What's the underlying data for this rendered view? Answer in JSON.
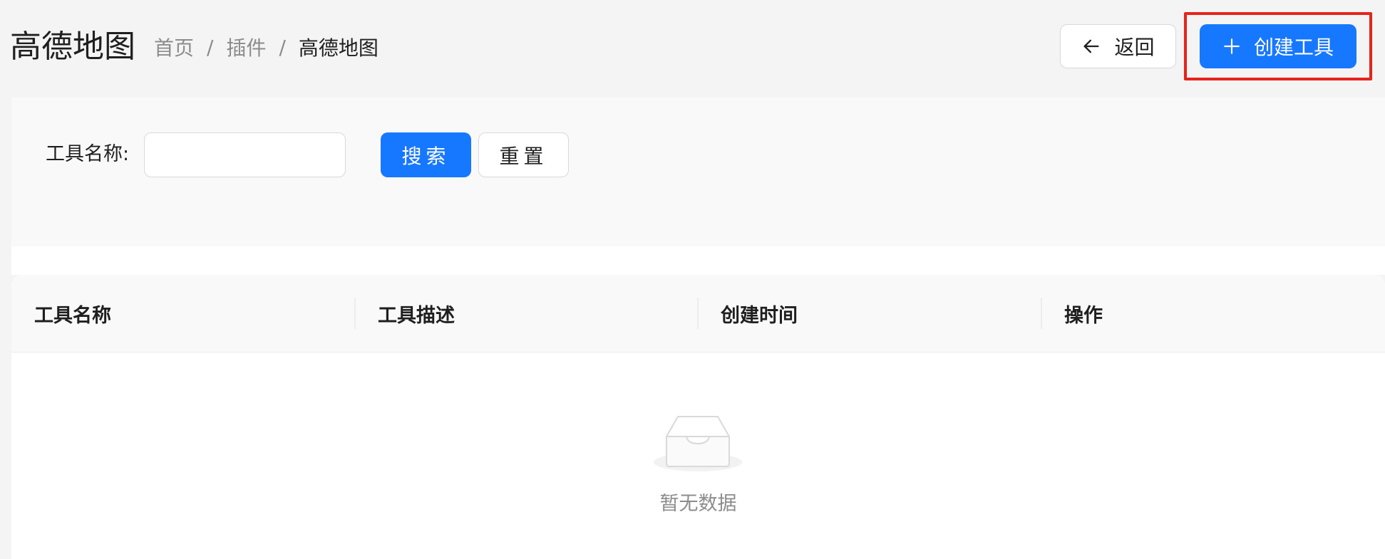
{
  "header": {
    "title": "高德地图",
    "breadcrumb": {
      "home": "首页",
      "separator1": "/",
      "plugins": "插件",
      "separator2": "/",
      "current": "高德地图"
    },
    "back_label": "返回",
    "create_label": "创建工具"
  },
  "search": {
    "label": "工具名称:",
    "input_value": "",
    "search_label": "搜索",
    "reset_label": "重置"
  },
  "table": {
    "columns": [
      "工具名称",
      "工具描述",
      "创建时间",
      "操作"
    ],
    "rows": [],
    "empty_text": "暂无数据"
  },
  "icons": {
    "back": "arrow-left-icon",
    "create": "plus-icon",
    "empty": "empty-inbox-icon"
  },
  "colors": {
    "primary": "#1677ff",
    "highlight": "#e8231b",
    "background": "#f4f4f4"
  }
}
